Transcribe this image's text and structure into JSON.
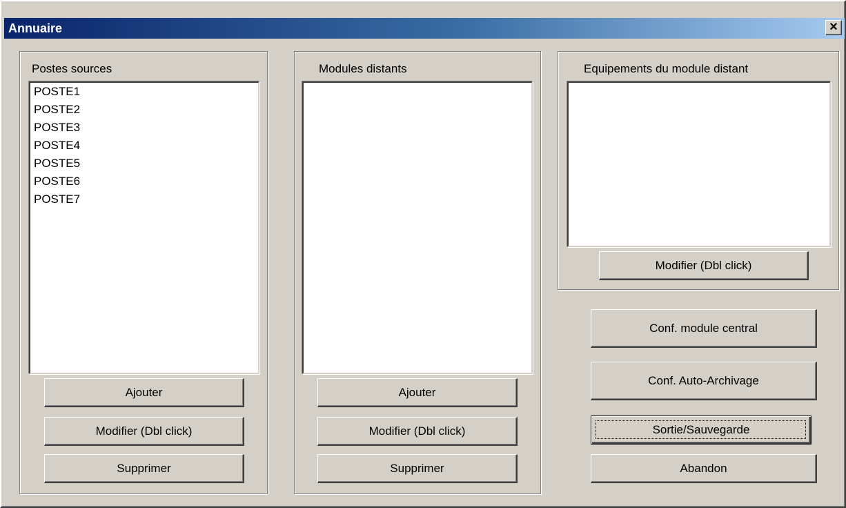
{
  "window": {
    "title": "Annuaire",
    "close_label": "×"
  },
  "postes_sources": {
    "label": "Postes sources",
    "items": [
      "POSTE1",
      "POSTE2",
      "POSTE3",
      "POSTE4",
      "POSTE5",
      "POSTE6",
      "POSTE7"
    ],
    "add_label": "Ajouter",
    "modify_label": "Modifier (Dbl click)",
    "delete_label": "Supprimer"
  },
  "modules_distants": {
    "label": "Modules distants",
    "items": [],
    "add_label": "Ajouter",
    "modify_label": "Modifier (Dbl click)",
    "delete_label": "Supprimer"
  },
  "equipements": {
    "label": "Equipements du module distant",
    "items": [],
    "modify_label": "Modifier (Dbl click)"
  },
  "actions": {
    "conf_central_label": "Conf. module central",
    "conf_archive_label": "Conf. Auto-Archivage",
    "save_exit_label": "Sortie/Sauvegarde",
    "abandon_label": "Abandon"
  },
  "colors": {
    "face": "#d4d0c8",
    "title_start": "#0a246a",
    "title_end": "#a6caf0"
  }
}
